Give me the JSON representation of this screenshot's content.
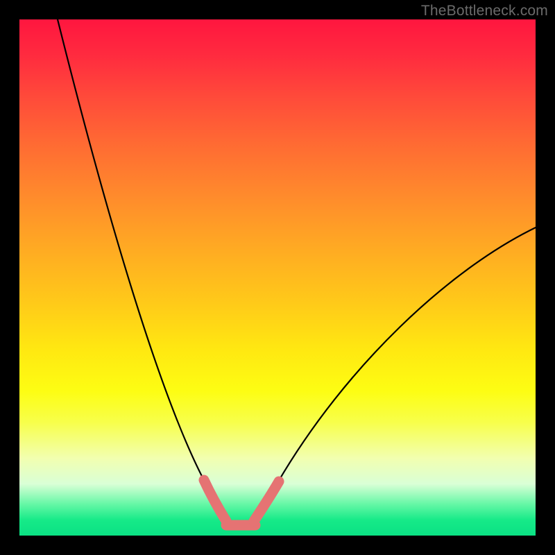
{
  "watermark": {
    "text": "TheBottleneck.com"
  },
  "chart_data": {
    "type": "line",
    "title": "",
    "xlabel": "",
    "ylabel": "",
    "xlim": [
      0,
      100
    ],
    "ylim": [
      0,
      100
    ],
    "series": [
      {
        "name": "bottleneck-curve",
        "x": [
          8,
          10,
          12,
          14,
          16,
          18,
          20,
          22,
          24,
          26,
          28,
          30,
          32,
          34,
          36,
          37,
          38,
          40,
          42,
          44,
          45,
          50,
          55,
          60,
          65,
          70,
          75,
          80,
          85,
          90,
          95,
          100
        ],
        "values": [
          100,
          93,
          86,
          79,
          72,
          65,
          58,
          51,
          45,
          39,
          33,
          27,
          22,
          17,
          11,
          8,
          5,
          2,
          1,
          0.5,
          0.5,
          1,
          4,
          8,
          14,
          20,
          27,
          34,
          41,
          48,
          54,
          60
        ]
      }
    ],
    "annotations": [
      {
        "name": "highlight-left-descent",
        "x_range": [
          34,
          38
        ],
        "style": "thick-pink"
      },
      {
        "name": "highlight-valley",
        "x_range": [
          38,
          44
        ],
        "style": "thick-pink"
      },
      {
        "name": "highlight-right-rise",
        "x_range": [
          44,
          49
        ],
        "style": "thick-pink"
      }
    ],
    "background": {
      "type": "vertical-gradient",
      "stops": [
        {
          "pct": 0,
          "color": "#ff163f"
        },
        {
          "pct": 50,
          "color": "#ffca19"
        },
        {
          "pct": 80,
          "color": "#f7ff4a"
        },
        {
          "pct": 100,
          "color": "#0be184"
        }
      ]
    }
  }
}
